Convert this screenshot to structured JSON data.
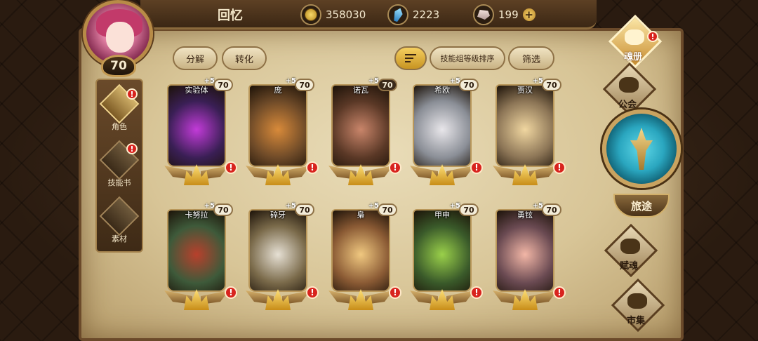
{
  "header": {
    "title": "回忆",
    "currencies": [
      {
        "icon": "gold-coin-icon",
        "value": "358030"
      },
      {
        "icon": "blue-crystal-icon",
        "value": "2223"
      },
      {
        "icon": "stone-icon",
        "value": "199"
      }
    ],
    "plus_label": "+"
  },
  "player": {
    "level": "70"
  },
  "sidebar": {
    "items": [
      {
        "label": "角色",
        "active": true,
        "alert": "!"
      },
      {
        "label": "技能书",
        "active": false,
        "alert": "!"
      },
      {
        "label": "素材",
        "active": false,
        "alert": ""
      }
    ]
  },
  "toolbar": {
    "decompose": "分解",
    "convert": "转化",
    "sort_label": "技能组等级排序",
    "filter": "筛选"
  },
  "cards": [
    {
      "name": "实验体",
      "level": "70",
      "plus": "+5",
      "color": "#3a1f55",
      "accent": "#c23bd8"
    },
    {
      "name": "庞",
      "level": "70",
      "plus": "+5",
      "color": "#6e4a28",
      "accent": "#d88a3a"
    },
    {
      "name": "诺瓦",
      "level": "70",
      "plus": "+5",
      "color": "#5a3826",
      "accent": "#c9856a"
    },
    {
      "name": "希欧",
      "level": "70",
      "plus": "+5",
      "color": "#8a8e96",
      "accent": "#e8e6ea"
    },
    {
      "name": "贾汉",
      "level": "70",
      "plus": "+5",
      "color": "#8c7556",
      "accent": "#f0d6a0"
    },
    {
      "name": "卡努拉",
      "level": "70",
      "plus": "+5",
      "color": "#3e5a3a",
      "accent": "#b8402c"
    },
    {
      "name": "碎牙",
      "level": "70",
      "plus": "+5",
      "color": "#7a6a4a",
      "accent": "#e6e0d4"
    },
    {
      "name": "梟",
      "level": "70",
      "plus": "+5",
      "color": "#8a5a34",
      "accent": "#f0c880"
    },
    {
      "name": "甲申",
      "level": "70",
      "plus": "+5",
      "color": "#3a5a2a",
      "accent": "#9ad04a"
    },
    {
      "name": "勇铉",
      "level": "70",
      "plus": "+5",
      "color": "#6a4a52",
      "accent": "#f2b6a6"
    }
  ],
  "alert_mark": "!",
  "right_nav": [
    {
      "label": "魂册",
      "active": true,
      "alert": "!"
    },
    {
      "label": "公会",
      "active": false,
      "alert": ""
    },
    {
      "label": "赋魂",
      "active": false,
      "alert": ""
    },
    {
      "label": "市集",
      "active": false,
      "alert": ""
    }
  ],
  "journey": {
    "label": "旅途"
  }
}
